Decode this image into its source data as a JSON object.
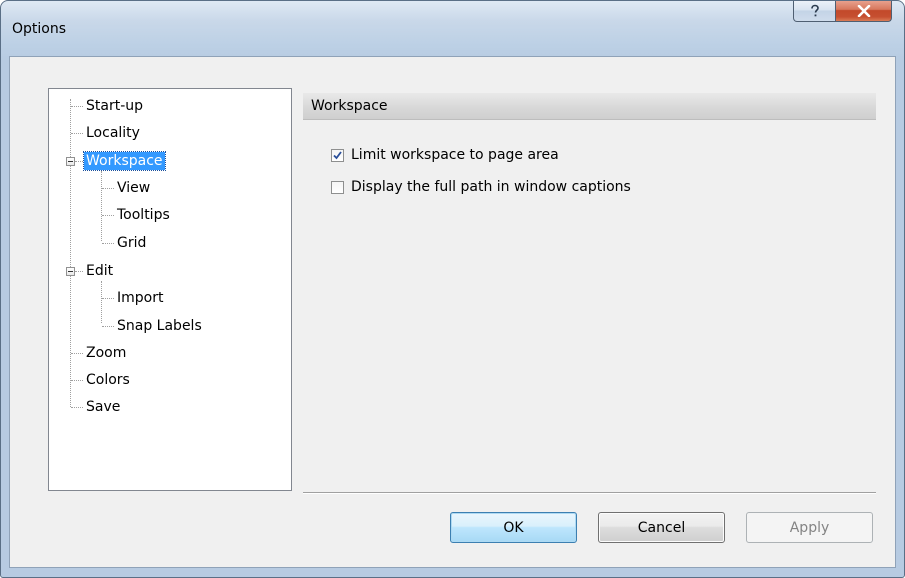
{
  "window": {
    "title": "Options",
    "help_icon": "question-mark-icon",
    "close_icon": "close-x-icon"
  },
  "tree": {
    "items": [
      {
        "label": "Start-up",
        "level": 0
      },
      {
        "label": "Locality",
        "level": 0
      },
      {
        "label": "Workspace",
        "level": 0,
        "expanded": true,
        "selected": true
      },
      {
        "label": "View",
        "level": 1
      },
      {
        "label": "Tooltips",
        "level": 1
      },
      {
        "label": "Grid",
        "level": 1
      },
      {
        "label": "Edit",
        "level": 0,
        "expanded": true
      },
      {
        "label": "Import",
        "level": 1
      },
      {
        "label": "Snap Labels",
        "level": 1
      },
      {
        "label": "Zoom",
        "level": 0
      },
      {
        "label": "Colors",
        "level": 0
      },
      {
        "label": "Save",
        "level": 0
      }
    ]
  },
  "panel": {
    "header": "Workspace",
    "options": [
      {
        "label": "Limit workspace to page area",
        "checked": true
      },
      {
        "label": "Display the full path in window captions",
        "checked": false
      }
    ]
  },
  "buttons": {
    "ok": "OK",
    "cancel": "Cancel",
    "apply": "Apply"
  },
  "colors": {
    "selection": "#3399ff",
    "close_button": "#c64f30",
    "ok_button_border": "#3c7fb1"
  }
}
